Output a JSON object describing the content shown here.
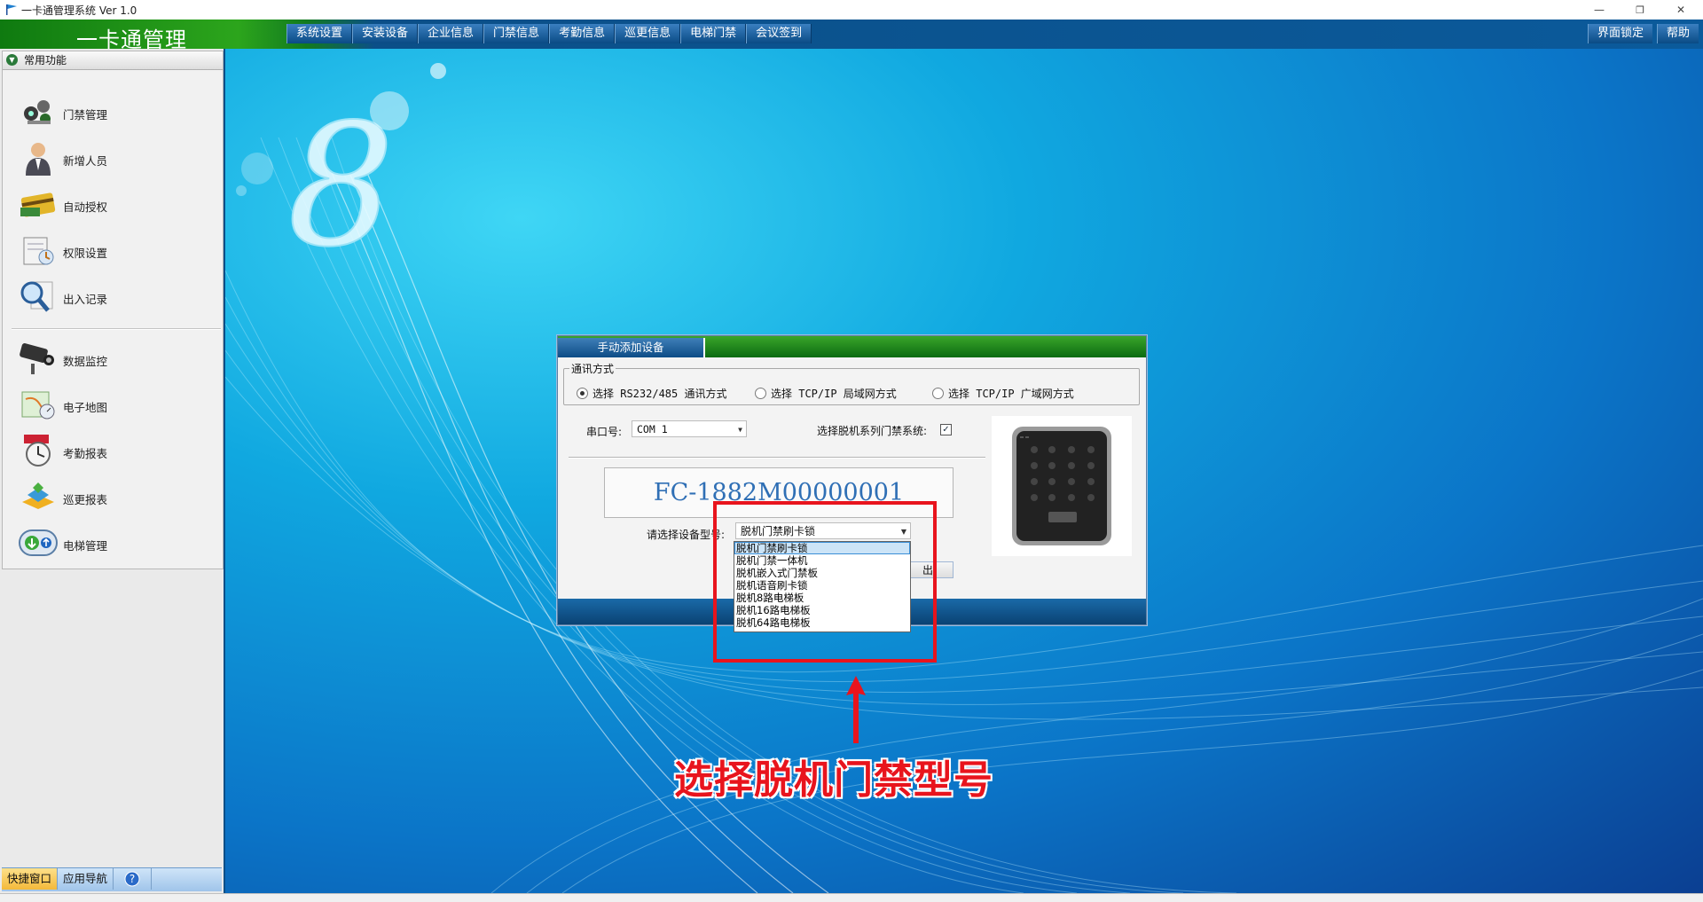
{
  "window": {
    "title": "一卡通管理系统 Ver 1.0",
    "minimize": "—",
    "restore": "❐",
    "close": "✕"
  },
  "menubar": {
    "logo": "一卡通管理",
    "items": [
      "系统设置",
      "安装设备",
      "企业信息",
      "门禁信息",
      "考勤信息",
      "巡更信息",
      "电梯门禁",
      "会议签到"
    ],
    "lock": "界面锁定",
    "help": "帮助"
  },
  "sidebar": {
    "panel_title": "常用功能",
    "items": [
      {
        "label": "门禁管理",
        "icon": "door-access-icon"
      },
      {
        "label": "新增人员",
        "icon": "person-icon"
      },
      {
        "label": "自动授权",
        "icon": "card-icon"
      },
      {
        "label": "权限设置",
        "icon": "permission-icon"
      },
      {
        "label": "出入记录",
        "icon": "magnifier-icon"
      },
      {
        "label": "数据监控",
        "icon": "camera-icon"
      },
      {
        "label": "电子地图",
        "icon": "map-icon"
      },
      {
        "label": "考勤报表",
        "icon": "clock-icon"
      },
      {
        "label": "巡更报表",
        "icon": "patrol-icon"
      },
      {
        "label": "电梯管理",
        "icon": "elevator-icon"
      }
    ],
    "tabs": [
      "快捷窗口",
      "应用导航"
    ]
  },
  "dialog": {
    "tab": "手动添加设备",
    "comm_group": "通讯方式",
    "radios": [
      "选择 RS232/485 通讯方式",
      "选择 TCP/IP 局域网方式",
      "选择 TCP/IP 广域网方式"
    ],
    "radio_selected": 0,
    "port_label": "串口号:",
    "port_value": "COM 1",
    "offline_label": "选择脱机系列门禁系统:",
    "offline_checked": true,
    "serial": "FC-1882M00000001",
    "model_label": "请选择设备型号:",
    "model_value": "脱机门禁刷卡锁",
    "partial_button": "出",
    "dropdown": [
      "脱机门禁刷卡锁",
      "脱机门禁一体机",
      "脱机嵌入式门禁板",
      "脱机语音刷卡锁",
      "脱机8路电梯板",
      "脱机16路电梯板",
      "脱机64路电梯板"
    ],
    "dropdown_selected": 0
  },
  "annotation": {
    "text": "选择脱机门禁型号",
    "color": "#e8141d"
  }
}
